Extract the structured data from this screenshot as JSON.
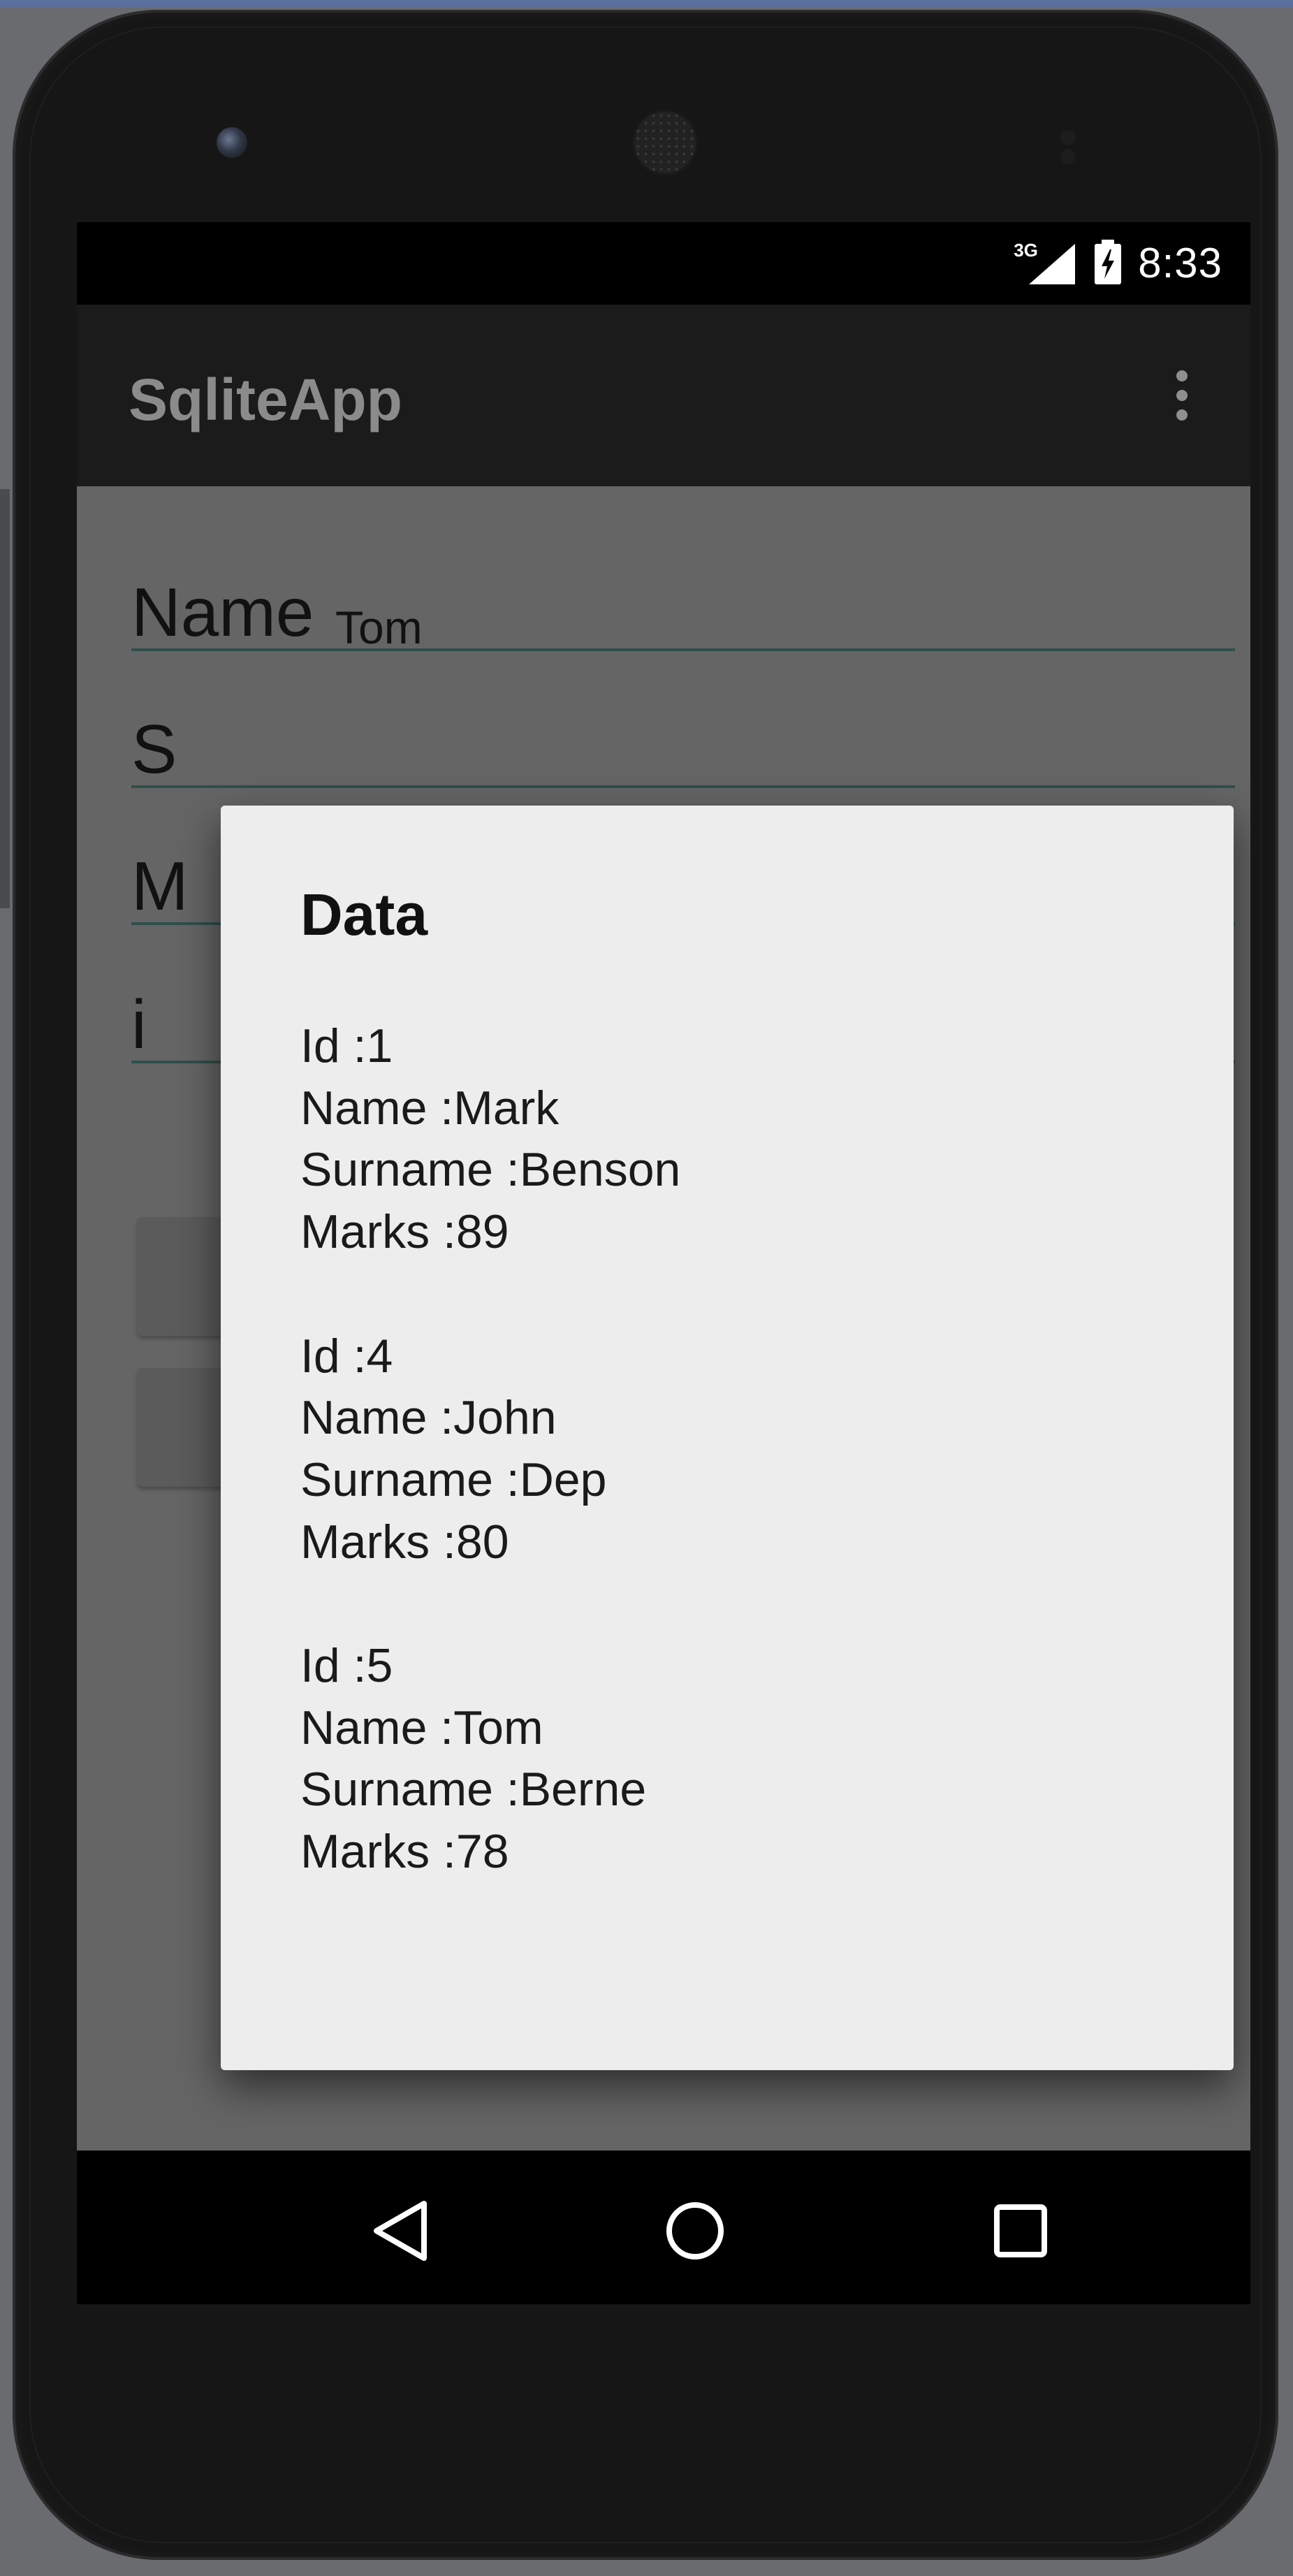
{
  "status_bar": {
    "network_type": "3G",
    "time": "8:33",
    "icons": [
      "signal-3g-icon",
      "battery-charging-icon"
    ]
  },
  "app_bar": {
    "title": "SqliteApp",
    "overflow_icon": "more-vert-icon"
  },
  "form": {
    "name_label": "Name",
    "name_value": "Tom",
    "surname_label_partial": "S",
    "marks_label_partial": "M",
    "id_label_partial": "i"
  },
  "dialog": {
    "title": "Data",
    "records": [
      {
        "id": "Id :1",
        "name": "Name :Mark",
        "surname": "Surname :Benson",
        "marks": "Marks :89"
      },
      {
        "id": "Id :4",
        "name": "Name :John",
        "surname": "Surname :Dep",
        "marks": "Marks :80"
      },
      {
        "id": "Id :5",
        "name": "Name :Tom",
        "surname": "Surname :Berne",
        "marks": "Marks :78"
      }
    ]
  },
  "nav_bar": {
    "back_icon": "back-triangle-icon",
    "home_icon": "home-circle-icon",
    "recents_icon": "recents-square-icon"
  },
  "colors": {
    "app_bar": "#1b1b1b",
    "scrim": "#656565",
    "dialog_bg": "#ededed",
    "title_text": "#8b8b8b"
  }
}
